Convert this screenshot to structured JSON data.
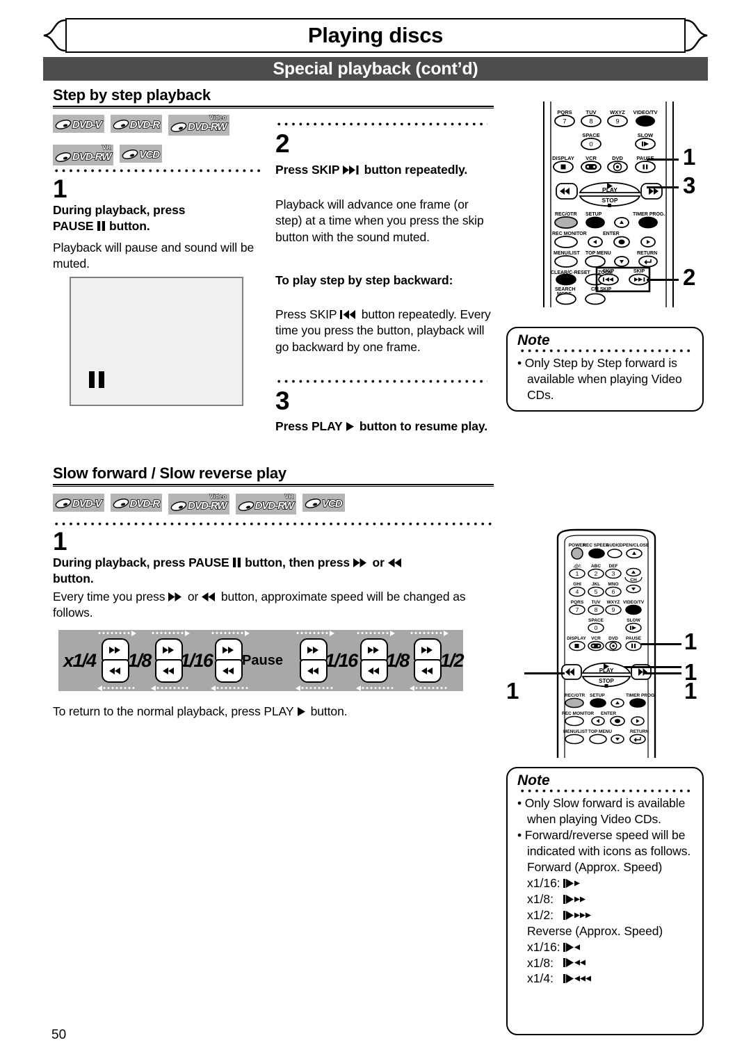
{
  "header": {
    "chapter_title": "Playing discs",
    "band_title": "Special playback (cont’d)"
  },
  "section1": {
    "heading": "Step by step playback",
    "badges": [
      {
        "label": "DVD-V",
        "sup": ""
      },
      {
        "label": "DVD-R",
        "sup": ""
      },
      {
        "label": "DVD-RW",
        "sup": "Video"
      },
      {
        "label": "DVD-RW",
        "sup": "VR"
      },
      {
        "label": "VCD",
        "sup": ""
      }
    ],
    "step1": {
      "number": "1",
      "bold_line1": "During playback, press",
      "bold_line2_pre": "PAUSE",
      "bold_line2_post": "button.",
      "body": "Playback will pause and sound will be muted."
    },
    "step2": {
      "number": "2",
      "bold_pre": "Press SKIP",
      "bold_post": "button repeatedly.",
      "body": "Playback will advance one frame (or step) at a time when you press the skip button with the sound muted.",
      "sub_heading": "To play step by step backward:",
      "sub_body_pre": "Press SKIP",
      "sub_body_post": "button repeatedly. Every time you press the button, playback will go backward by one frame."
    },
    "step3": {
      "number": "3",
      "bold_pre": "Press PLAY",
      "bold_post": "button to resume play."
    },
    "note": {
      "title": "Note",
      "items": [
        "Only Step by Step forward is available when playing Video CDs."
      ]
    },
    "callouts": [
      "1",
      "3",
      "2"
    ]
  },
  "section2": {
    "heading": "Slow forward / Slow reverse play",
    "badges": [
      {
        "label": "DVD-V",
        "sup": ""
      },
      {
        "label": "DVD-R",
        "sup": ""
      },
      {
        "label": "DVD-RW",
        "sup": "Video"
      },
      {
        "label": "DVD-RW",
        "sup": "VR"
      },
      {
        "label": "VCD",
        "sup": ""
      }
    ],
    "step1": {
      "number": "1",
      "bold_a": "During playback, press PAUSE",
      "bold_b": "button, then press",
      "bold_c": "or",
      "bold_d": "button.",
      "body_a": "Every time you press",
      "body_b": "or",
      "body_c": "button, approximate speed will be changed as follows."
    },
    "speed_strip": {
      "items": [
        "x1/4",
        "x1/8",
        "x1/16",
        "Pause",
        "x1/16",
        "x1/8",
        "x1/2"
      ]
    },
    "return_text_pre": "To return to the normal playback, press PLAY",
    "return_text_post": "button.",
    "note": {
      "title": "Note",
      "items": [
        "Only Slow forward is available when playing Video CDs.",
        "Forward/reverse speed will be indicated with icons as follows."
      ],
      "forward_heading": "Forward (Approx. Speed)",
      "forward_rows": [
        {
          "label": "x1/16:",
          "arrows": 1,
          "dir": "fwd"
        },
        {
          "label": "x1/8:",
          "arrows": 2,
          "dir": "fwd"
        },
        {
          "label": "x1/2:",
          "arrows": 3,
          "dir": "fwd"
        }
      ],
      "reverse_heading": "Reverse (Approx. Speed)",
      "reverse_rows": [
        {
          "label": "x1/16:",
          "arrows": 1,
          "dir": "rev"
        },
        {
          "label": "x1/8:",
          "arrows": 2,
          "dir": "rev"
        },
        {
          "label": "x1/4:",
          "arrows": 3,
          "dir": "rev"
        }
      ]
    },
    "callouts": [
      "1",
      "1",
      "1",
      "1"
    ]
  },
  "remote_top": {
    "rows": [
      {
        "labels": [
          "PQRS",
          "TUV",
          "WXYZ",
          "VIDEO/TV"
        ],
        "keys": [
          "7",
          "8",
          "9",
          ""
        ]
      },
      {
        "labels": [
          "",
          "SPACE",
          "",
          "SLOW"
        ],
        "keys": [
          "",
          "0",
          "",
          ""
        ]
      },
      {
        "labels": [
          "DISPLAY",
          "VCR",
          "DVD",
          "PAUSE"
        ],
        "keys": [
          "",
          "",
          "",
          ""
        ]
      }
    ],
    "play": "PLAY",
    "stop": "STOP",
    "fn_labels": [
      "REC/OTR",
      "SETUP",
      "TIMER PROG.",
      "REC MONITOR",
      "ENTER",
      "MENU/LIST",
      "TOP MENU",
      "RETURN",
      "CLEAR/C-RESET",
      "ZOOM",
      "SKIP",
      "SKIP",
      "SEARCH MODE",
      "CM SKIP"
    ]
  },
  "remote_bottom": {
    "top_labels": [
      "POWER",
      "REC SPEED",
      "AUDIO",
      "OPEN/CLOSE"
    ],
    "keypad": [
      {
        "label": ".@/:",
        "key": "1"
      },
      {
        "label": "ABC",
        "key": "2"
      },
      {
        "label": "DEF",
        "key": "3"
      },
      {
        "label": "GHI",
        "key": "4"
      },
      {
        "label": "JKL",
        "key": "5"
      },
      {
        "label": "MNO",
        "key": "6"
      },
      {
        "label": "PQRS",
        "key": "7"
      },
      {
        "label": "TUV",
        "key": "8"
      },
      {
        "label": "WXYZ",
        "key": "9"
      },
      {
        "label": "SPACE",
        "key": "0"
      }
    ],
    "ch": "CH",
    "video_tv": "VIDEO/TV",
    "slow": "SLOW",
    "row_labels": [
      "DISPLAY",
      "VCR",
      "DVD",
      "PAUSE"
    ],
    "play": "PLAY",
    "stop": "STOP",
    "fn_labels": [
      "REC/OTR",
      "SETUP",
      "TIMER PROG.",
      "REC MONITOR",
      "ENTER",
      "MENU/LIST",
      "TOP MENU",
      "RETURN"
    ]
  },
  "page_number": "50"
}
